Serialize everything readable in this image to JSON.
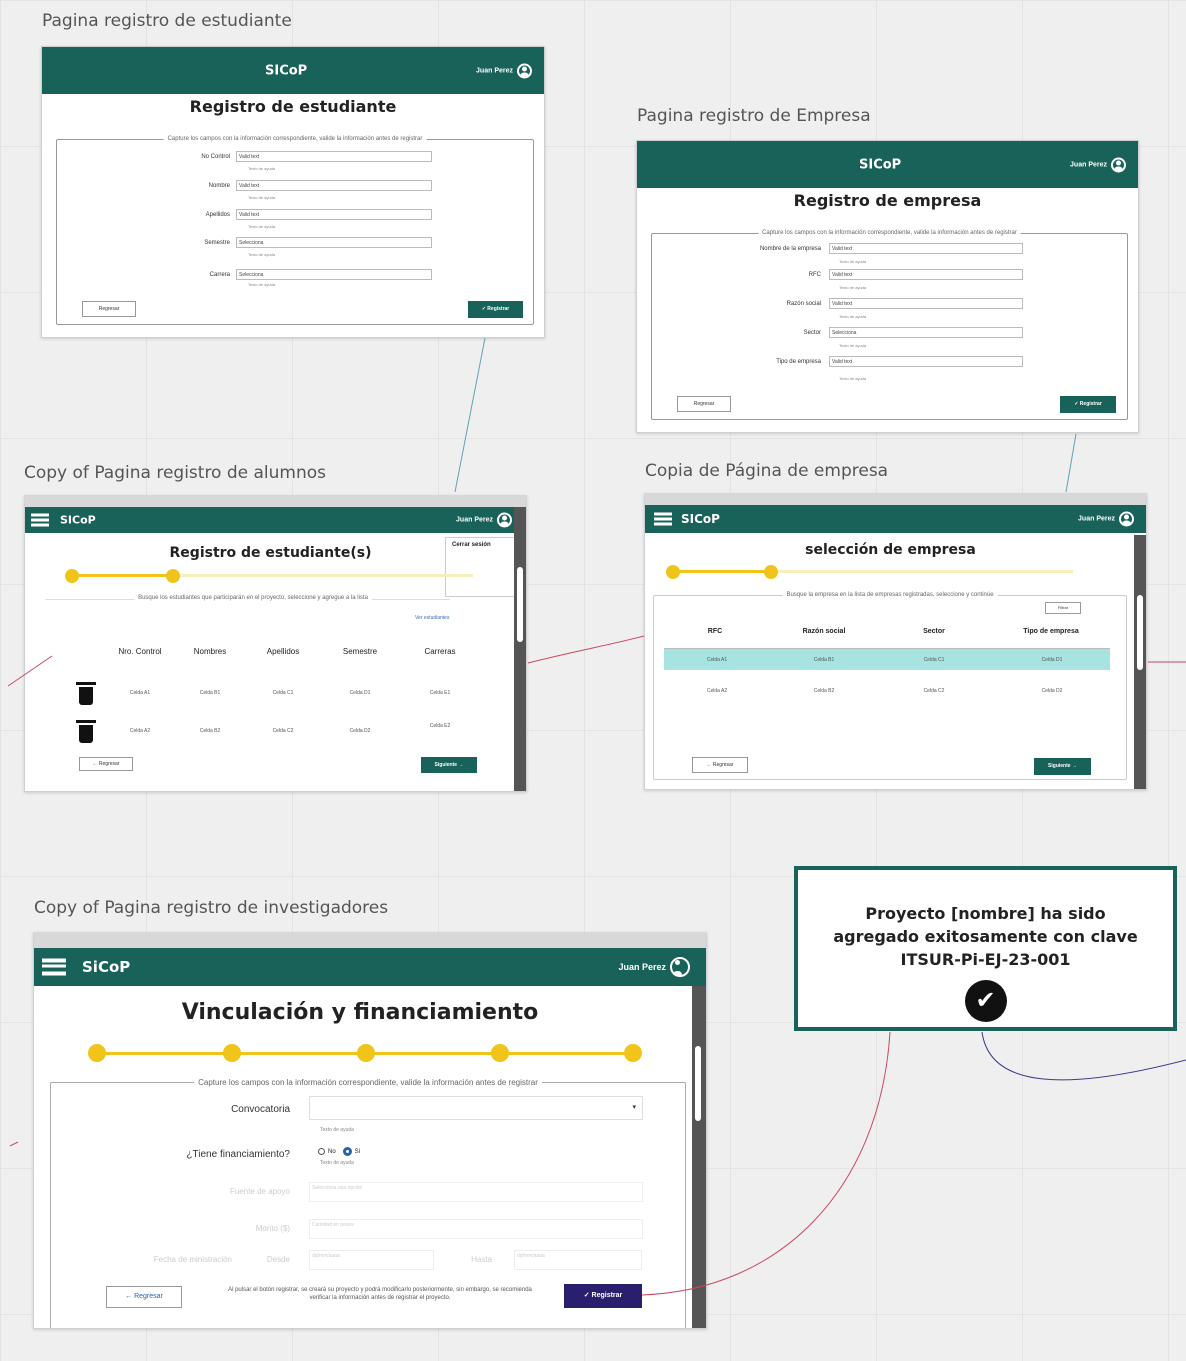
{
  "frames": {
    "student_reg": {
      "frame_label": "Pagina registro de estudiante",
      "brand": "SICoP",
      "user": "Juan Perez",
      "title": "Registro de estudiante",
      "legend": "Capture los campos con la información correspondiente, valide la información antes de registrar",
      "fields": [
        {
          "label": "No Control",
          "value": "Valid text",
          "help": "Texto de ayuda"
        },
        {
          "label": "Nombre",
          "value": "Valid text",
          "help": "Texto de ayuda"
        },
        {
          "label": "Apellidos",
          "value": "Valid text",
          "help": "Texto de ayuda"
        },
        {
          "label": "Semestre",
          "value": "Selecciona",
          "help": "Texto de ayuda"
        },
        {
          "label": "Carrera",
          "value": "Selecciona",
          "help": "Texto de ayuda"
        }
      ],
      "back_label": "Regresar",
      "submit_label": "✓ Registrar"
    },
    "company_reg": {
      "frame_label": "Pagina registro de Empresa",
      "brand": "SICoP",
      "user": "Juan Perez",
      "title": "Registro de empresa",
      "legend": "Capture los campos con la información correspondiente, valide la información antes de registrar",
      "fields": [
        {
          "label": "Nombre de la empresa",
          "value": "Valid text",
          "help": "Texto de ayuda"
        },
        {
          "label": "RFC",
          "value": "Valid text",
          "help": "Texto de ayuda"
        },
        {
          "label": "Razón social",
          "value": "Valid text",
          "help": "Texto de ayuda"
        },
        {
          "label": "Sector",
          "value": "Selecciona",
          "help": "Texto de ayuda"
        },
        {
          "label": "Tipo de empresa",
          "value": "Valid text",
          "help": "Texto de ayuda"
        }
      ],
      "back_label": "Regresar",
      "submit_label": "✓ Registrar"
    },
    "students_copy": {
      "frame_label": "Copy of Pagina registro de alumnos",
      "brand": "SICoP",
      "user": "Juan Perez",
      "title": "Registro de estudiante(s)",
      "menu_item": "Cerrar sesión",
      "instruction": "Busque los estudiantes que participarán en el proyecto, seleccione y agregue a la lista",
      "link_label": "Ver estudiantes",
      "headers": [
        "Nro. Control",
        "Nombres",
        "Apellidos",
        "Semestre",
        "Carreras"
      ],
      "rows": [
        [
          "Celda A1",
          "Celda B1",
          "Celda C1",
          "Celda D1",
          "Celda E1"
        ],
        [
          "Celda A2",
          "Celda B2",
          "Celda C2",
          "Celda D2",
          "Celda E2"
        ]
      ],
      "back_label": "← Regresar",
      "next_label": "Siguiente →"
    },
    "company_copy": {
      "frame_label": "Copia de Página de empresa",
      "brand": "SICoP",
      "user": "Juan Perez",
      "title": "selección de empresa",
      "instruction": "Busque la empresa en la lista de empresas registradas, seleccione y continúe",
      "filter_label": "Filtrar",
      "headers": [
        "RFC",
        "Razón social",
        "Sector",
        "Tipo de empresa"
      ],
      "rows": [
        [
          "Celda A1",
          "Celda B1",
          "Celda C1",
          "Celda D1"
        ],
        [
          "Celda A2",
          "Celda B2",
          "Celda C2",
          "Celda D2"
        ]
      ],
      "back_label": "← Regresar",
      "next_label": "Siguiente →"
    },
    "investigators_copy": {
      "frame_label": "Copy of Pagina registro de investigadores",
      "brand": "SiCoP",
      "user": "Juan Perez",
      "title": "Vinculación y financiamiento",
      "legend": "Capture los campos con la información correspondiente, valide la información antes de registrar",
      "convocatoria_label": "Convocatoria",
      "convocatoria_help": "Texto de ayuda",
      "financing_label": "¿Tiene financiamiento?",
      "radio_no": "No",
      "radio_si": "Sí",
      "radio_help": "Texto de ayuda",
      "faint_fields": [
        {
          "label": "Fuente de apoyo",
          "value": "Selecciona una opción"
        },
        {
          "label": "Monto ($)",
          "value": "Cantidad en pesos"
        }
      ],
      "faint_row": {
        "label": "Fecha de ministración",
        "from_label": "Desde",
        "from_value": "dd/mm/aaaa",
        "to_label": "Hasta",
        "to_value": "dd/mm/aaaa"
      },
      "back_label": "← Regresar",
      "warning": "Al pulsar el botón registrar, se creará su proyecto y podrá modificarlo posteriormente, sin embargo, se recomienda verificar la información antes de registrar el proyecto.",
      "submit_label": "✓ Registrar"
    }
  },
  "modal": {
    "message": "Proyecto [nombre] ha sido agregado exitosamente con clave ITSUR-Pi-EJ-23-001",
    "icon": "check-circle-icon"
  },
  "colors": {
    "brand_green": "#18625a",
    "step_yellow": "#f0c419",
    "submit_purple": "#2a1f6e",
    "highlight_row": "#a7e3e0"
  }
}
